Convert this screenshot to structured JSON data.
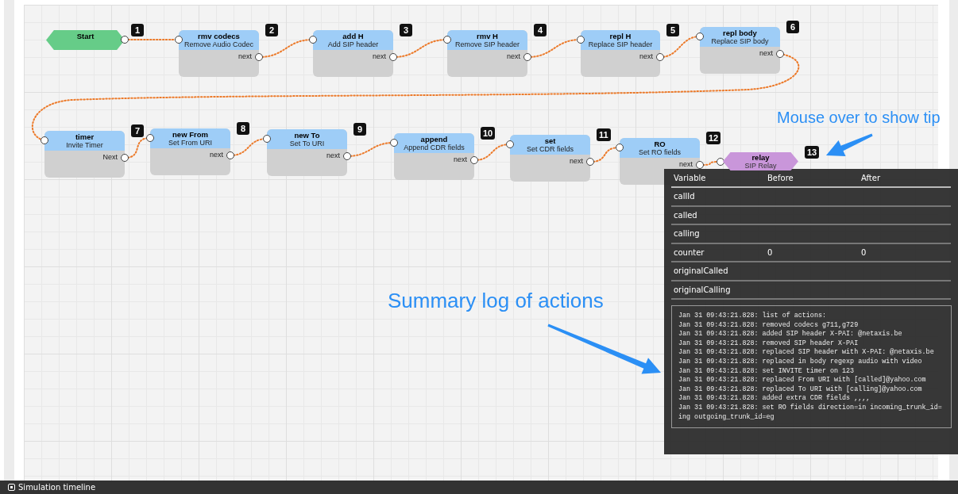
{
  "canvas": {
    "nodes": [
      {
        "kind": "start",
        "badge": "1",
        "title": "Start"
      },
      {
        "kind": "action",
        "badge": "2",
        "title": "rmv codecs",
        "subtitle": "Remove Audio Codec",
        "output": "next"
      },
      {
        "kind": "action",
        "badge": "3",
        "title": "add H",
        "subtitle": "Add SIP header",
        "output": "next"
      },
      {
        "kind": "action",
        "badge": "4",
        "title": "rmv H",
        "subtitle": "Remove SIP header",
        "output": "next"
      },
      {
        "kind": "action",
        "badge": "5",
        "title": "repl H",
        "subtitle": "Replace SIP header",
        "output": "next"
      },
      {
        "kind": "action",
        "badge": "6",
        "title": "repl body",
        "subtitle": "Replace SIP body",
        "output": "next"
      },
      {
        "kind": "action",
        "badge": "7",
        "title": "timer",
        "subtitle": "Invite Timer",
        "output": "Next"
      },
      {
        "kind": "action",
        "badge": "8",
        "title": "new From",
        "subtitle": "Set From URI",
        "output": "next"
      },
      {
        "kind": "action",
        "badge": "9",
        "title": "new To",
        "subtitle": "Set To URI",
        "output": "next"
      },
      {
        "kind": "action",
        "badge": "10",
        "title": "append",
        "subtitle": "Append CDR fields",
        "output": "next"
      },
      {
        "kind": "action",
        "badge": "11",
        "title": "set",
        "subtitle": "Set CDR fields",
        "output": "next"
      },
      {
        "kind": "action",
        "badge": "12",
        "title": "RO",
        "subtitle": "Set RO fields",
        "output": "next"
      },
      {
        "kind": "end",
        "badge": "13",
        "title": "relay",
        "subtitle": "SIP Relay"
      }
    ]
  },
  "annotations": [
    {
      "text": "Mouse over to show tip"
    },
    {
      "text": "Summary log of actions"
    }
  ],
  "tooltip": {
    "columns": [
      "Variable",
      "Before",
      "After"
    ],
    "rows": [
      [
        "callId"
      ],
      [
        "called"
      ],
      [
        "calling"
      ],
      [
        "counter",
        "0",
        "0"
      ],
      [
        "originalCalled"
      ],
      [
        "originalCalling"
      ]
    ],
    "log": [
      "Jan 31 09:43:21.828: list of actions:",
      "Jan 31 09:43:21.828: removed codecs g711,g729",
      "Jan 31 09:43:21.828: added SIP header X-PAI: @netaxis.be",
      "Jan 31 09:43:21.828: removed SIP header X-PAI",
      "Jan 31 09:43:21.828: replaced SIP header with X-PAI: @netaxis.be",
      "Jan 31 09:43:21.828: replaced in body regexp audio with video",
      "Jan 31 09:43:21.828: set INVITE timer on 123",
      "Jan 31 09:43:21.828: replaced From URI with [called]@yahoo.com",
      "Jan 31 09:43:21.828: replaced To URI with [calling]@yahoo.com",
      "Jan 31 09:43:21.828: added extra CDR fields ,,,,",
      "Jan 31 09:43:21.828: set RO fields direction=in incoming_trunk_id=ing outgoing_trunk_id=eg"
    ]
  },
  "status_bar": {
    "label": "Simulation timeline"
  }
}
